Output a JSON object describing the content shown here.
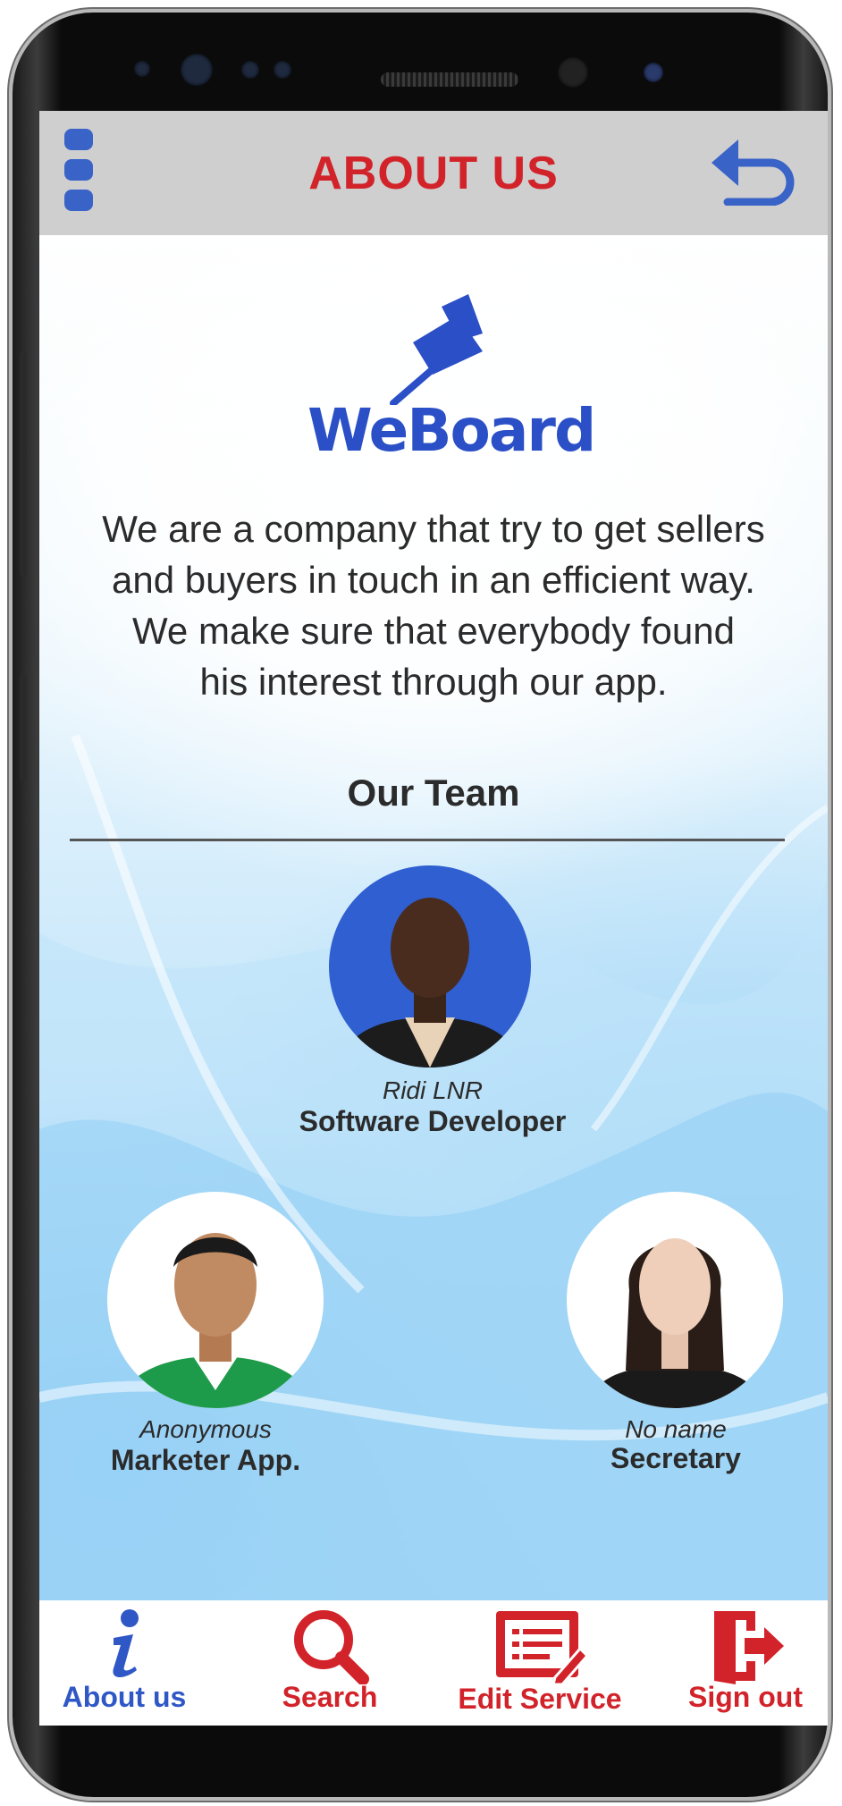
{
  "app": {
    "title": "ABOUT US"
  },
  "brand": {
    "name": "WeBoard"
  },
  "about": {
    "lines": [
      "We are a company that try to get sellers",
      "and buyers in touch in an efficient way.",
      "We make sure that everybody found",
      "his interest through our app."
    ]
  },
  "team": {
    "heading": "Our Team",
    "members": [
      {
        "name": "Ridi LNR",
        "role": "Software Developer"
      },
      {
        "name": "Anonymous",
        "role": "Marketer App."
      },
      {
        "name": "No name",
        "role": "Secretary"
      }
    ]
  },
  "nav": {
    "items": [
      {
        "label": "About us",
        "icon": "info-icon",
        "active": true
      },
      {
        "label": "Search",
        "icon": "search-icon",
        "active": false
      },
      {
        "label": "Edit Service",
        "icon": "edit-service-icon",
        "active": false
      },
      {
        "label": "Sign out",
        "icon": "sign-out-icon",
        "active": false
      }
    ]
  },
  "colors": {
    "accent_red": "#d2232a",
    "accent_blue": "#2f57c5",
    "appbar_bg": "#cfcfcf"
  }
}
